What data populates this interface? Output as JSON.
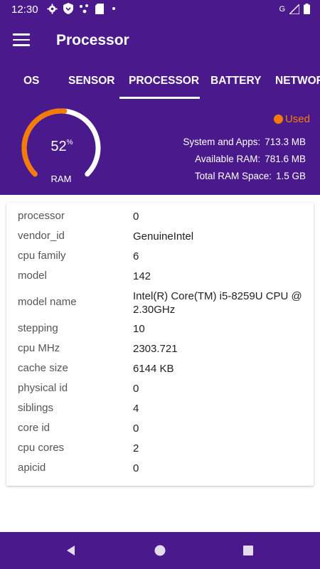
{
  "status_bar": {
    "time": "12:30",
    "network_label": "G"
  },
  "app_bar": {
    "title": "Processor",
    "menu_icon": "hamburger-menu-icon"
  },
  "tabs": [
    {
      "label": "OS",
      "active": false
    },
    {
      "label": "SENSOR",
      "active": false
    },
    {
      "label": "PROCESSOR",
      "active": true
    },
    {
      "label": "BATTERY",
      "active": false
    },
    {
      "label": "NETWORK",
      "active": false
    }
  ],
  "ram": {
    "percent_value": "52",
    "percent_sign": "%",
    "percent": 52,
    "label": "RAM",
    "legend_label": "Used",
    "stats": [
      {
        "label": "System and Apps:",
        "value": "713.3 MB"
      },
      {
        "label": "Available RAM:",
        "value": "781.6 MB"
      },
      {
        "label": "Total RAM Space:",
        "value": "1.5 GB"
      }
    ]
  },
  "cpu_info": [
    {
      "key": "processor",
      "value": "0"
    },
    {
      "key": "vendor_id",
      "value": "GenuineIntel"
    },
    {
      "key": "cpu family",
      "value": "6"
    },
    {
      "key": "model",
      "value": "142"
    },
    {
      "key": "model name",
      "value": "Intel(R) Core(TM) i5-8259U CPU @ 2.30GHz"
    },
    {
      "key": "stepping",
      "value": "10"
    },
    {
      "key": "cpu MHz",
      "value": "2303.721"
    },
    {
      "key": "cache size",
      "value": "6144 KB"
    },
    {
      "key": "physical id",
      "value": "0"
    },
    {
      "key": "siblings",
      "value": "4"
    },
    {
      "key": "core id",
      "value": "0"
    },
    {
      "key": "cpu cores",
      "value": "2"
    },
    {
      "key": "apicid",
      "value": "0"
    }
  ],
  "colors": {
    "primary": "#4a1a8c",
    "accent": "#f57c00",
    "gauge_track": "#ffffff"
  }
}
